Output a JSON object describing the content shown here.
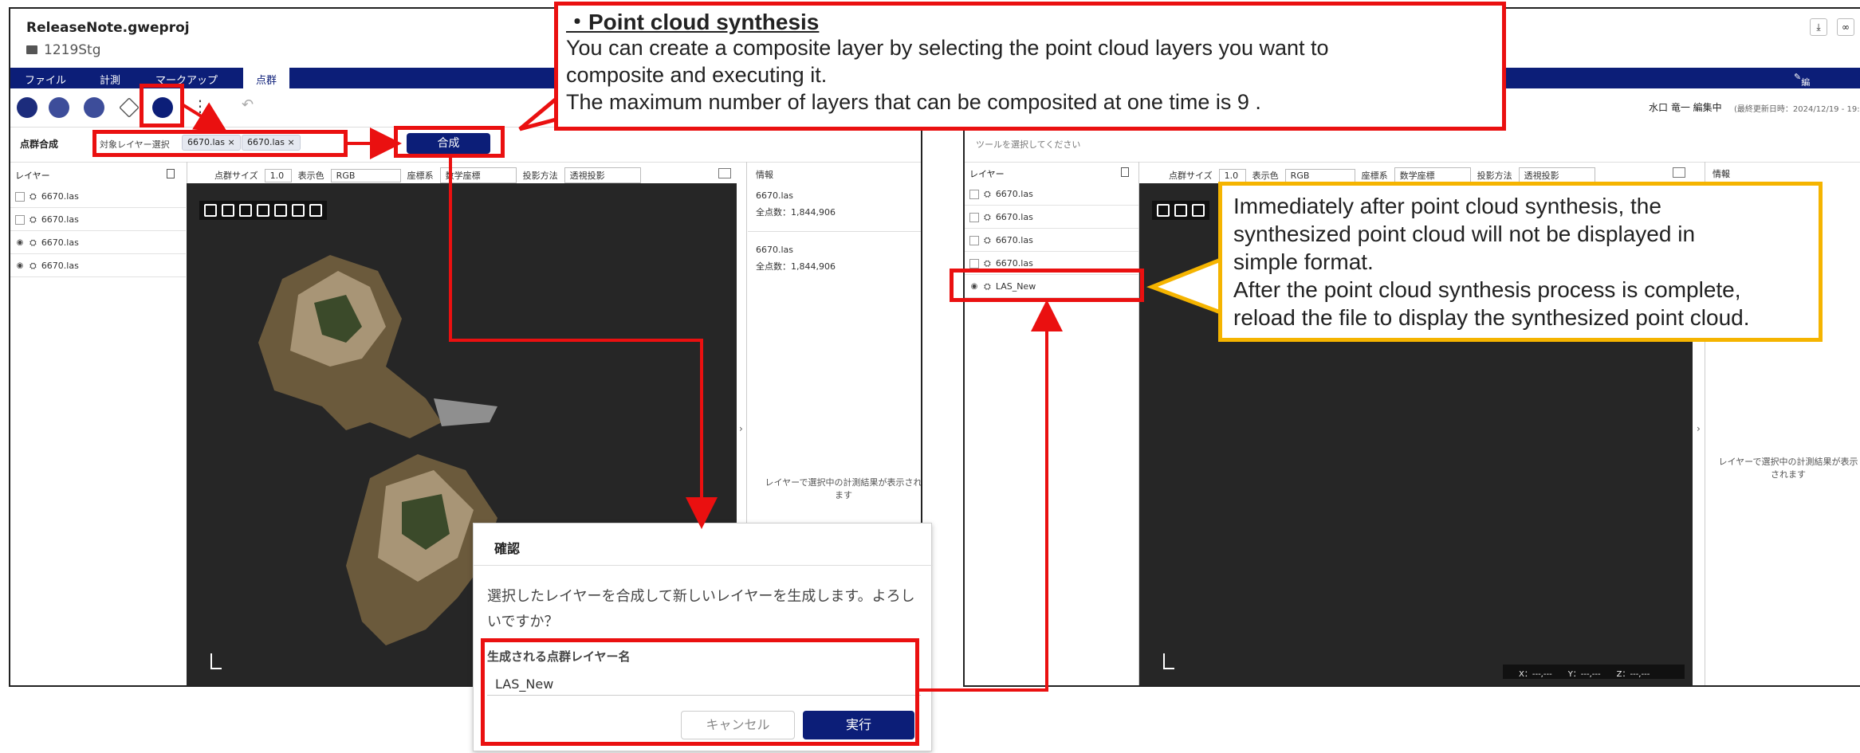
{
  "left_app": {
    "project_name": "ReleaseNote.gweproj",
    "stage": "1219Stg",
    "menu": [
      "ファイル",
      "計測",
      "マークアップ",
      "点群"
    ],
    "active_menu": "点群",
    "toolbar2": {
      "title": "点群合成",
      "target_layers_label": "対象レイヤー選択",
      "chips": [
        "6670.las",
        "6670.las"
      ],
      "merge_button": "合成"
    },
    "layers_title": "レイヤー",
    "layers": [
      {
        "name": "6670.las",
        "visible": false
      },
      {
        "name": "6670.las",
        "visible": false
      },
      {
        "name": "6670.las",
        "visible": true
      },
      {
        "name": "6670.las",
        "visible": true
      }
    ],
    "viewer_bar": {
      "point_size_label": "点群サイズ",
      "point_size_value": "1.0",
      "display_color_label": "表示色",
      "display_color_value": "RGB",
      "coord_label": "座標系",
      "coord_value": "数学座標",
      "projection_label": "投影方法",
      "projection_value": "透視投影"
    },
    "info": {
      "title": "情報",
      "entries": [
        {
          "file": "6670.las",
          "count": "全点数：1,844,906"
        },
        {
          "file": "6670.las",
          "count": "全点数：1,844,906"
        }
      ],
      "hint": "レイヤーで選択中の計測結果が表示されます"
    }
  },
  "dialog": {
    "title": "確認",
    "message": "選択したレイヤーを合成して新しいレイヤーを生成します。よろしいですか？",
    "field_label": "生成される点群レイヤー名",
    "field_value": "LAS_New",
    "cancel": "キャンセル",
    "execute": "実行"
  },
  "right_app": {
    "editing_badge": "編集中",
    "user_status": "水口 竜一 編集中",
    "last_updated": "(最終更新日時：2024/12/19 - 19:",
    "tool_hint": "ツールを選択してください",
    "layers_title": "レイヤー",
    "layers": [
      {
        "name": "6670.las",
        "visible": false
      },
      {
        "name": "6670.las",
        "visible": false
      },
      {
        "name": "6670.las",
        "visible": false
      },
      {
        "name": "6670.las",
        "visible": false
      },
      {
        "name": "LAS_New",
        "visible": true
      }
    ],
    "viewer_bar": {
      "point_size_label": "点群サイズ",
      "point_size_value": "1.0",
      "display_color_label": "表示色",
      "display_color_value": "RGB",
      "coord_label": "座標系",
      "coord_value": "数学座標",
      "projection_label": "投影方法",
      "projection_value": "透視投影"
    },
    "info_title": "情報",
    "info_hint": "レイヤーで選択中の計測結果が表示されます",
    "coords": {
      "x": "X：---,---",
      "y": "Y：---,---",
      "z": "Z：---,---"
    }
  },
  "callout_top": {
    "title": "・Point cloud synthesis",
    "lines": [
      "You can create a composite layer by selecting the point cloud layers you want to",
      "composite and executing it.",
      "The maximum number of layers that can be composited at one time is 9 ."
    ]
  },
  "callout_right": {
    "lines": [
      "Immediately after point cloud synthesis, the",
      "synthesized point cloud will not be displayed in",
      "simple format.",
      "After the point cloud synthesis process is complete,",
      "reload the file to display the synthesized point cloud."
    ]
  },
  "colors": {
    "navy": "#0c1e78",
    "annotation_red": "#ea1010",
    "callout_orange": "#f5b400",
    "viewer_bg": "#262626"
  }
}
